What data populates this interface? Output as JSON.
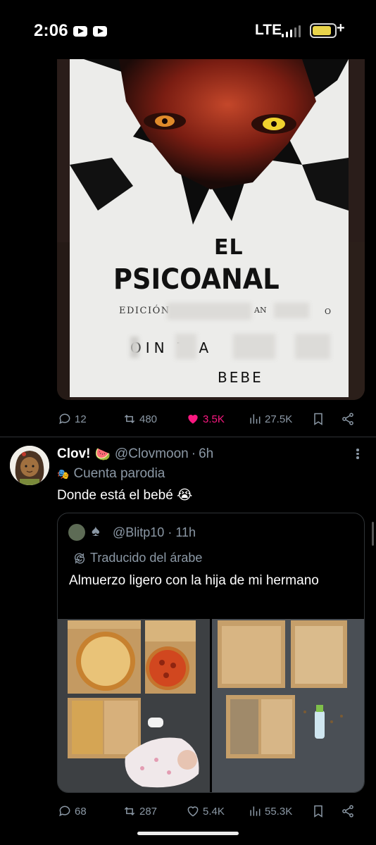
{
  "status_bar": {
    "time": "2:06",
    "network": "LTE"
  },
  "top_tweet": {
    "image": {
      "title_line1": "EL",
      "title_line2": "PSICOANAL",
      "edition_text": "EDICIÓN",
      "edition_fragment": "AN",
      "edition_tail": "O",
      "author_fragment": "OIN  T    A",
      "bebe_text": "BEBE"
    },
    "actions": {
      "replies": "12",
      "reposts": "480",
      "likes": "3.5K",
      "views": "27.5K"
    }
  },
  "tweet": {
    "display_name": "Clov!",
    "name_emoji": "🍉",
    "handle": "@Clovmoon",
    "separator": "·",
    "time": "6h",
    "parody_label": "Cuenta parodia",
    "text": "Donde está el bebé 😭",
    "quoted": {
      "handle": "@Blitp10",
      "separator": "·",
      "time": "11h",
      "translated_label": "Traducido del árabe",
      "text": "Almuerzo ligero con la hija de mi hermano"
    },
    "actions": {
      "replies": "68",
      "reposts": "287",
      "likes": "5.4K",
      "views": "55.3K"
    }
  },
  "colors": {
    "muted": "#8b98a5",
    "like": "#f91880",
    "background": "#000000",
    "divider": "#2f3336"
  },
  "icons": [
    "reply-icon",
    "repost-icon",
    "like-icon",
    "views-icon",
    "bookmark-icon",
    "share-icon",
    "translate-icon",
    "parody-mask-icon",
    "more-icon"
  ]
}
